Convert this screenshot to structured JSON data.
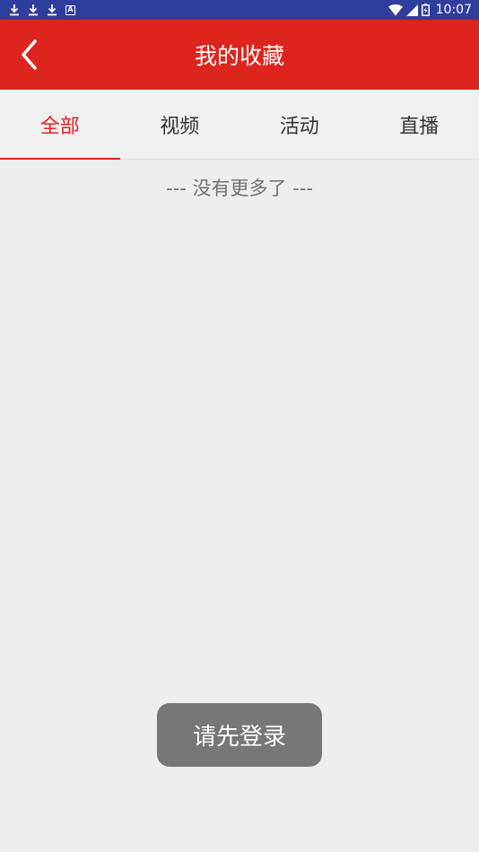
{
  "status_bar": {
    "time": "10:07",
    "left_icons": [
      "download-icon",
      "download-icon",
      "download-icon",
      "a-badge-icon"
    ],
    "a_badge_text": "A",
    "right_icons": [
      "wifi-icon",
      "signal-icon",
      "battery-icon"
    ]
  },
  "app_bar": {
    "title": "我的收藏",
    "back_icon": "chevron-left-icon",
    "color": "#dd241d"
  },
  "tabs": [
    {
      "label": "全部",
      "active": true
    },
    {
      "label": "视频",
      "active": false
    },
    {
      "label": "活动",
      "active": false
    },
    {
      "label": "直播",
      "active": false
    }
  ],
  "content": {
    "no_more_text": "--- 没有更多了 ---"
  },
  "toast": {
    "text": "请先登录"
  },
  "colors": {
    "status_bar": "#2f3e9e",
    "accent": "#dd241d",
    "background": "#eeeeee"
  }
}
